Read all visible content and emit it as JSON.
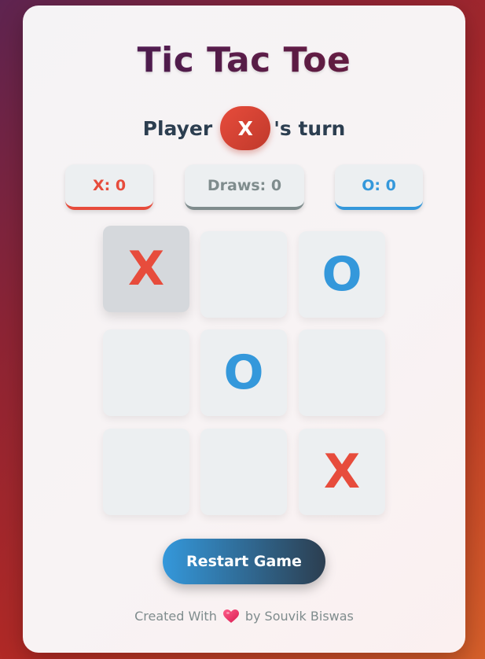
{
  "title": "Tic Tac Toe",
  "turn": {
    "prefix": "Player",
    "player": "X",
    "suffix": "'s turn"
  },
  "scores": {
    "x": "X: 0",
    "draws": "Draws: 0",
    "o": "O: 0"
  },
  "board": [
    "X",
    "",
    "O",
    "",
    "O",
    "",
    "",
    "",
    "X"
  ],
  "restart_label": "Restart Game",
  "footer": {
    "prefix": "Created With",
    "icon": "heart-icon",
    "suffix": "by Souvik Biswas"
  },
  "colors": {
    "x": "#e74c3c",
    "o": "#3498db",
    "draw": "#7f8c8d",
    "text": "#2c3e50"
  }
}
